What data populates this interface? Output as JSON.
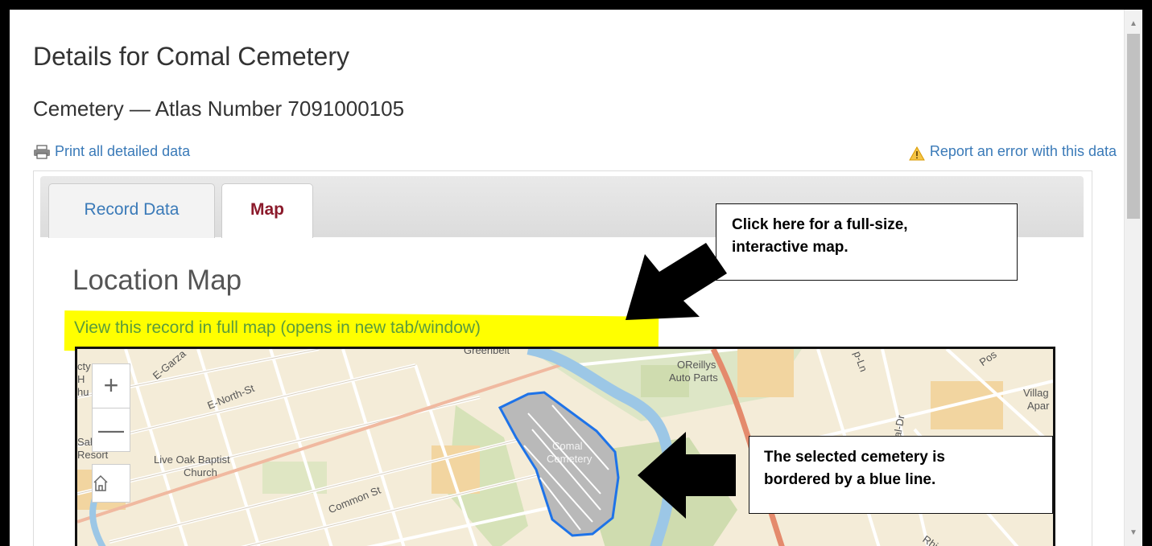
{
  "page": {
    "title": "Details for Comal Cemetery",
    "subtitle": "Cemetery — Atlas Number 7091000105",
    "print_link": "Print all detailed data",
    "report_link": "Report an error with this data"
  },
  "tabs": [
    {
      "label": "Record Data",
      "active": false
    },
    {
      "label": "Map",
      "active": true
    }
  ],
  "map_section": {
    "heading": "Location Map",
    "full_map_link": "View this record in full map (opens in new tab/window)",
    "zoom_in": "+",
    "zoom_out": "—",
    "home_icon": "home-icon",
    "labels": {
      "greenbelt": "Greenbelt",
      "egarza": "E-Garza",
      "enorth": "E-North-St",
      "oreillys": "OReillys",
      "autoparts": "Auto Parts",
      "village": "Villag",
      "apar": "Apar",
      "comal": "Comal",
      "cemetery": "Cemetery",
      "liveoak": "Live Oak Baptist",
      "church": "Church",
      "common": "Common St",
      "shah": "Sah",
      "resort": "Resort",
      "cty": "cty",
      "h": "H",
      "ihu": "hu",
      "pos": "Pos",
      "ialdr": "ial-Dr",
      "pln": "p-Ln",
      "rhi": "Rhi"
    }
  },
  "annotations": {
    "callout_top": [
      "Click here for a full-size,",
      "interactive map."
    ],
    "callout_bottom": [
      "The selected cemetery is",
      "bordered by a blue line."
    ]
  },
  "colors": {
    "link": "#3a7ab8",
    "active_tab": "#8b1a2b",
    "highlight": "#ffff00",
    "cemetery_border": "#1e73e8"
  }
}
